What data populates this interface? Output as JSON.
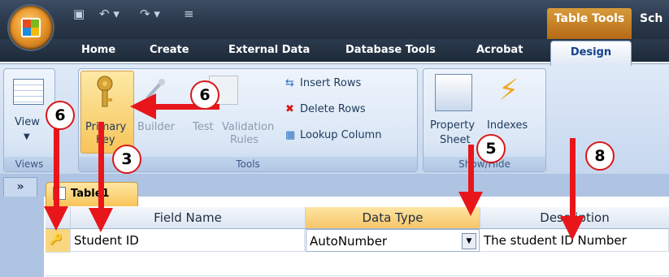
{
  "titlebar": {
    "table_tools": "Table Tools",
    "school": "Sch"
  },
  "tabs": [
    "Home",
    "Create",
    "External Data",
    "Database Tools",
    "Acrobat",
    "Design"
  ],
  "ribbon": {
    "views": {
      "view_label": "View",
      "group_label": "Views"
    },
    "tools": {
      "primary_key_1": "Primary",
      "primary_key_2": "Key",
      "builder": "Builder",
      "test": "Test",
      "validation_1": "Validation",
      "validation_2": "Rules",
      "insert_rows": "Insert Rows",
      "delete_rows": "Delete Rows",
      "lookup_column": "Lookup Column",
      "group_label": "Tools"
    },
    "showhide": {
      "property_1": "Property",
      "property_2": "Sheet",
      "indexes": "Indexes",
      "group_label": "Show/Hide"
    }
  },
  "nav": {
    "chevron": "»",
    "doc_tab": "Table1"
  },
  "grid": {
    "headers": [
      "Field Name",
      "Data Type",
      "Description"
    ],
    "row": {
      "field_name": "Student ID",
      "data_type": "AutoNumber",
      "description": "The student ID Number"
    }
  },
  "annotations": [
    "6",
    "6",
    "3",
    "5",
    "8"
  ],
  "colors": {
    "arrow": "#e8161b",
    "tab_highlight": "#f8c257"
  }
}
